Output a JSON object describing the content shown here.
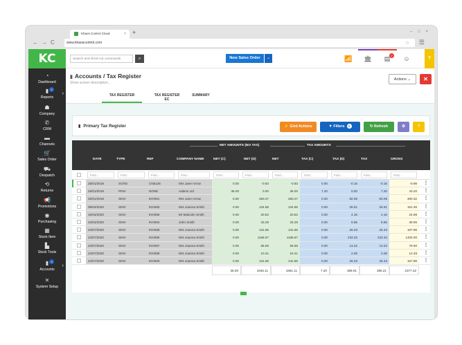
{
  "browser": {
    "tab_title": "Khaos Control Cloud",
    "url": "www.khaoscontrol.com",
    "new_tab": "+",
    "window_controls": "– □ ×"
  },
  "logo": "KC",
  "sidebar": {
    "items": [
      {
        "label": "Dashboard",
        "icon": "dashboard-icon"
      },
      {
        "label": "Reports",
        "icon": "reports-icon",
        "badge": "2",
        "arrow": true
      },
      {
        "label": "Company",
        "icon": "company-icon"
      },
      {
        "label": "CRM",
        "icon": "phone-icon"
      },
      {
        "label": "Channels",
        "icon": "channels-icon"
      },
      {
        "label": "Sales Order",
        "icon": "cart-icon"
      },
      {
        "label": "Despatch",
        "icon": "truck-icon"
      },
      {
        "label": "Returns",
        "icon": "returns-icon"
      },
      {
        "label": "Promotions",
        "icon": "megaphone-icon"
      },
      {
        "label": "Purchasing",
        "icon": "purchasing-icon"
      },
      {
        "label": "Stock Item",
        "icon": "stock-item-icon"
      },
      {
        "label": "Stock Tools",
        "icon": "stock-tools-icon"
      },
      {
        "label": "Accounts",
        "icon": "accounts-icon",
        "badge": "3",
        "arrow": true
      },
      {
        "label": "System Setup",
        "icon": "wrench-icon"
      }
    ]
  },
  "topbar": {
    "search_placeholder": "Search and short-cut commands",
    "new_sales_order": "New Sales Order",
    "notification_badge": "2",
    "accent_colors": {
      "purple": "#7b3fb5",
      "red": "#e53935",
      "yellow": "#f5c400",
      "blue": "#1976d2",
      "green": "#43b649"
    },
    "help": "?"
  },
  "page": {
    "section": "Accounts",
    "separator": " / ",
    "title": "Tax Register",
    "description_placeholder": "Show screen description...",
    "actions_label": "Actions",
    "close_label": "✕"
  },
  "tabs": [
    {
      "label": "TAX REGISTER",
      "active": true
    },
    {
      "label": "TAX REGISTER EC",
      "active": false
    },
    {
      "label": "SUMMARY",
      "active": false
    }
  ],
  "card": {
    "title": "Primary Tax Register",
    "grid_actions": "Grid Actions",
    "filters": "Filters",
    "filters_count": "1",
    "refresh": "Refresh"
  },
  "grid": {
    "group_headers": {
      "net_amounts": "NET AMOUNTS (NO TAX)",
      "tax_amounts": "TAX AMOUNTS"
    },
    "columns": [
      "DATE",
      "TYPE",
      "REF",
      "COMPANY NAME",
      "NET (C)",
      "NET (D)",
      "NET",
      "TAX (C)",
      "TAX (D)",
      "TAX",
      "GROSS"
    ],
    "filter_placeholder": "Find...",
    "rows": [
      [
        "25/01/2018",
        "SCRD",
        "CN5126",
        "Mrs Jane Arrow",
        "0.00",
        "-0.83",
        "-0.83",
        "0.00",
        "-0.16",
        "-0.16",
        "-0.99"
      ],
      [
        "25/01/2018",
        "PINV",
        "NONE",
        "Adams Ltd",
        "36.00",
        "0.00",
        "36.00",
        "7.20",
        "0.00",
        "7.20",
        "43.20"
      ],
      [
        "25/01/2018",
        "SINV",
        "INV591",
        "Mrs Jane Arrow",
        "0.00",
        "250.27",
        "250.27",
        "0.00",
        "50.05",
        "50.05",
        "300.32"
      ],
      [
        "09/04/2020",
        "SINV",
        "INV593",
        "Mrs Joanna Smith",
        "0.00",
        "134.58",
        "134.58",
        "0.00",
        "26.91",
        "26.91",
        "161.49"
      ],
      [
        "15/04/2020",
        "SINV",
        "INV595",
        "Mr Malcolm Smith",
        "0.00",
        "20.82",
        "20.82",
        "0.00",
        "4.16",
        "4.16",
        "24.98"
      ],
      [
        "23/04/2020",
        "SINV",
        "INV594",
        "John Smith",
        "0.00",
        "33.29",
        "33.29",
        "0.00",
        "6.66",
        "6.66",
        "39.95"
      ],
      [
        "24/07/2020",
        "SINV",
        "INV598",
        "Mrs Joanna Smith",
        "0.00",
        "131.66",
        "131.66",
        "0.00",
        "26.33",
        "26.33",
        "157.99"
      ],
      [
        "24/07/2020",
        "SINV",
        "INV596",
        "Mrs Joanna Smith",
        "0.00",
        "1166.67",
        "1166.67",
        "0.00",
        "233.33",
        "233.33",
        "1400.00"
      ],
      [
        "24/07/2020",
        "SINV",
        "INV597",
        "Mrs Joanna Smith",
        "0.00",
        "66.58",
        "66.58",
        "0.00",
        "13.32",
        "13.32",
        "79.90"
      ],
      [
        "24/07/2020",
        "SINV",
        "INV599",
        "Mrs Joanna Smith",
        "0.00",
        "10.41",
        "10.41",
        "0.00",
        "2.08",
        "2.08",
        "12.49"
      ],
      [
        "24/07/2020",
        "SINV",
        "INV600",
        "Mrs Joanna Smith",
        "0.00",
        "131.66",
        "131.66",
        "0.00",
        "26.33",
        "26.33",
        "157.99"
      ]
    ],
    "totals": [
      "36.00",
      "1945.11",
      "1981.11",
      "7.20",
      "389.01",
      "396.21",
      "2377.32"
    ]
  }
}
